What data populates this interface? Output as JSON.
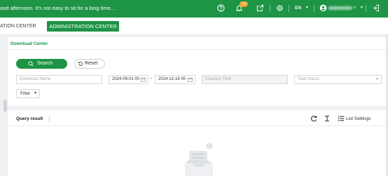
{
  "header": {
    "greeting": "ood afternoon. It's not easy to sit for a long time...",
    "notification_count": "10",
    "language": "EN",
    "user_suffix": "s",
    "icons": [
      "help-icon",
      "bell-icon",
      "external-link-icon",
      "gear-icon",
      "globe-icon",
      "user-icon",
      "logout-icon"
    ]
  },
  "nav": {
    "tab_partial": "ATION CENTER",
    "tab_active": "ADMINISTRATION CENTER"
  },
  "download_center": {
    "title": "Download Center",
    "search_label": "Search",
    "reset_label": "Reset",
    "download_name_placeholder": "Download Name",
    "start_date": "2024-09-01 00",
    "end_date": "2024-12-16 00",
    "date_separator": "-",
    "creation_time_placeholder": "Creation Time",
    "task_status_placeholder": "Task Status",
    "filter_label": "Filter"
  },
  "query_result": {
    "title": "Query result",
    "list_settings_label": "List Settings"
  },
  "colors": {
    "brand_green": "#1e9445",
    "badge_orange": "#f0a02a"
  }
}
